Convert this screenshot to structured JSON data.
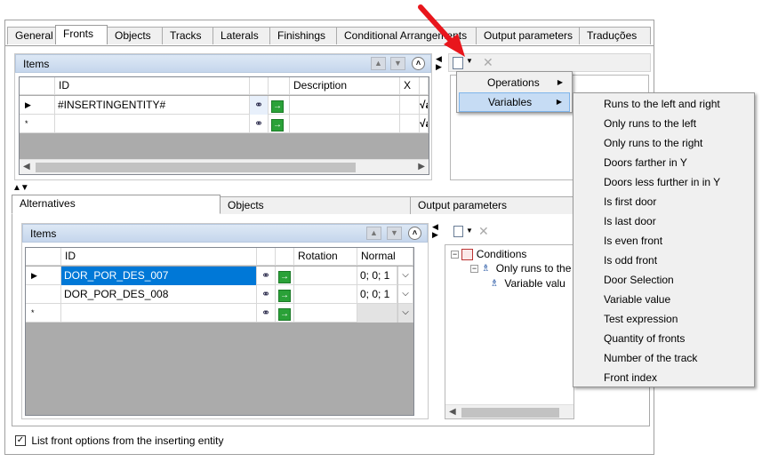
{
  "main_tabs": [
    "General",
    "Fronts",
    "Objects",
    "Tracks",
    "Laterals",
    "Finishings",
    "Conditional Arrangements",
    "Output parameters",
    "Traduções"
  ],
  "main_tab_active": "Fronts",
  "top_items": {
    "header": "Items",
    "columns": [
      "ID",
      "Description",
      "X"
    ],
    "rows": [
      {
        "marker": "▶",
        "id": "#INSERTINGENTITY#",
        "description": "",
        "x": "√a"
      },
      {
        "marker": "*",
        "id": "",
        "description": "",
        "x": "√a"
      }
    ]
  },
  "mid_arrows": "▲▼",
  "sub_tabs": [
    "Alternatives",
    "Objects",
    "Output parameters"
  ],
  "sub_tab_active": "Alternatives",
  "bottom_items": {
    "header": "Items",
    "columns": [
      "ID",
      "Rotation",
      "Normal"
    ],
    "rows": [
      {
        "marker": "▶",
        "id": "DOR_POR_DES_007",
        "rotation": "",
        "normal": "0; 0; 1",
        "selected": true
      },
      {
        "marker": "",
        "id": "DOR_POR_DES_008",
        "rotation": "",
        "normal": "0; 0; 1",
        "selected": false
      },
      {
        "marker": "*",
        "id": "",
        "rotation": "",
        "normal": "",
        "selected": false
      }
    ]
  },
  "tree": {
    "root": "Conditions",
    "child": "Only runs to the r",
    "grandchild": "Variable valu"
  },
  "context_menu": {
    "items": [
      {
        "label": "Operations",
        "submenu": true,
        "highlighted": false
      },
      {
        "label": "Variables",
        "submenu": true,
        "highlighted": true
      }
    ]
  },
  "variables_submenu": [
    "Runs to the left and right",
    "Only runs to the left",
    "Only runs to the right",
    "Doors farther in Y",
    "Doors less further in in Y",
    "Is first door",
    "Is last door",
    "Is even front",
    "Is odd front",
    "Door Selection",
    "Variable value",
    "Test expression",
    "Quantity of fronts",
    "Number of the track",
    "Front index"
  ],
  "checkbox": {
    "label": "List front options from the inserting entity",
    "checked": true
  },
  "colors": {
    "selection": "#0078d7",
    "header": "#c5d6ec",
    "arrow": "#e8161c"
  }
}
